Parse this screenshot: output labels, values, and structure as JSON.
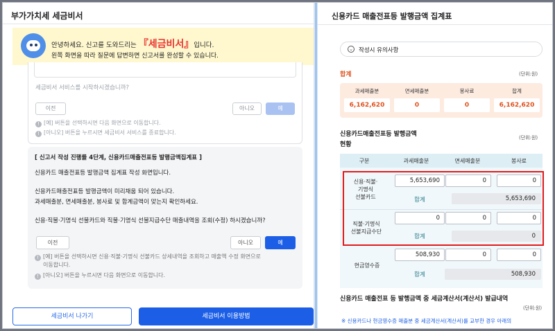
{
  "left": {
    "title": "부가가치세 세금비서",
    "banner": {
      "greeting_prefix": "안녕하세요. 신고를 도와드리는",
      "brand": "『세금비서』",
      "greeting_suffix": "입니다.",
      "line2": "왼쪽 화면을 따라 질문에 답변하면 신고서를 완성할 수 있습니다."
    },
    "card1": {
      "question": "세금비서 서비스를 시작하시겠습니까?",
      "prev_label": "이전",
      "no_label": "아니오",
      "yes_label": "예",
      "note1": "[예] 버튼을 선택하시면 다음 화면으로 이동합니다.",
      "note2": "[아니오] 버튼을 누르시면 세금비서 서비스를 종료합니다."
    },
    "card2": {
      "title": "[ 신고서 작성 진행률 4단계, 신용카드매출전표등 발행금액집계표 ]",
      "line1": "신용카드 매출전표등 발행금액 집계표 작성 화면입니다.",
      "line2": "신용카드매출전표등 발행금액이 미리채움 되어 있습니다.",
      "line3": "과세매출분, 면세매출분, 봉사료 및 합계금액이 맞는지 확인하세요.",
      "line4": "신용·직불·기명식 선불카드와 직불·기명식 선불지급수단 매출내역을 조회(수정) 하시겠습니까?",
      "prev_label": "이전",
      "no_label": "아니오",
      "yes_label": "예",
      "note1a": "[예] 버튼을 선택하시면 신용·직불·기명식 선불카드 상세내역을 조회하고 매출액 수정 화면으로",
      "note1b": "이동합니다.",
      "note2": "[아니오] 버튼을 누르시면 다음 화면으로 이동합니다."
    },
    "exit_label": "세금비서 나가기",
    "guide_label": "세금비서 이용방법"
  },
  "right": {
    "title": "신용카드 매출전표등 발행금액 집계표",
    "notice_label": "작성시 유의사항",
    "summary": {
      "title": "합계",
      "unit": "(단위:원)",
      "headers": [
        "과세매출분",
        "면세매출분",
        "봉사료",
        "합계"
      ],
      "values": [
        "6,162,620",
        "0",
        "0",
        "6,162,620"
      ]
    },
    "status": {
      "title_line1": "신용카드매출전표등 발행금액",
      "title_line2": "현황",
      "unit": "(단위:원)",
      "headers": [
        "구분",
        "과세매출분",
        "면세매출분",
        "봉사료"
      ],
      "rows": [
        {
          "label_lines": [
            "신용·직불·",
            "기명식",
            "선불카드"
          ],
          "values": [
            "5,653,690",
            "0",
            "0"
          ],
          "sum_label": "합계",
          "sum_value": "5,653,690"
        },
        {
          "label_lines": [
            "직불·기명식",
            "선불지급수단"
          ],
          "values": [
            "0",
            "0",
            "0"
          ],
          "sum_label": "합계",
          "sum_value": "0"
        },
        {
          "label_lines": [
            "현금영수증"
          ],
          "values": [
            "508,930",
            "0",
            "0"
          ],
          "sum_label": "합계",
          "sum_value": "508,930"
        }
      ]
    },
    "footer": {
      "title": "신용카드 매출전표 등 발행금액 중 세금계산서(계산서) 발급내역",
      "unit": "(단위:원)",
      "note": "※ 신용카드나 현금영수증 매출분 중 세금계산서(계산서)를 교부한 경우 아래의"
    }
  }
}
